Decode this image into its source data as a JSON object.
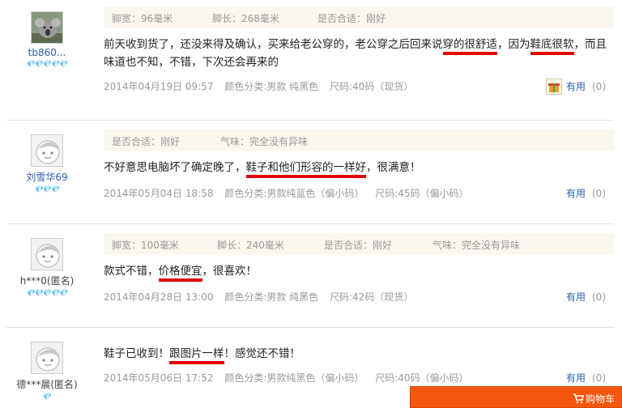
{
  "reviews": [
    {
      "user": {
        "name": "tb860...",
        "hearts": "💎💎💎💎💎"
      },
      "attrs": [
        "脚宽：96毫米",
        "脚长：268毫米",
        "是否合适：刚好"
      ],
      "content": {
        "p1": "前天收到货了，还没来得及确认，买来给老公穿的，老公穿之后回来说",
        "h1": "穿的很舒适",
        "p2": "，因为",
        "h2": "鞋底很软",
        "p3": "，而且味道也不知，不错，下次还会再来的"
      },
      "date": "2014年04月19日 09:57",
      "color": "颜色分类:男款 纯黑色",
      "size": "尺码:40码（现货）",
      "useful_label": "有用",
      "useful_count": "(0)"
    },
    {
      "user": {
        "name": "刘雪华69",
        "hearts": "💎💎💎"
      },
      "attrs": [
        "是否合适：刚好",
        "气味：完全没有异味"
      ],
      "content": {
        "p1": "不好意思电脑坏了确定晚了，",
        "h1": "鞋子和他们形容的一样好",
        "p2": "，很满意！"
      },
      "date": "2014年05月04日 18:58",
      "color": "颜色分类:男款纯蓝色（偏小码）",
      "size": "尺码:45码（偏小码）",
      "useful_label": "有用",
      "useful_count": "(0)"
    },
    {
      "user": {
        "name": "h***0(匿名)",
        "hearts": "💎💎💎💎💎"
      },
      "attrs": [
        "脚宽：100毫米",
        "脚长：240毫米",
        "是否合适：刚好",
        "气味：完全没有异味"
      ],
      "content": {
        "p1": "款式不错，",
        "h1": "价格便宜",
        "p2": "，很喜欢！"
      },
      "date": "2014年04月28日 13:00",
      "color": "颜色分类:男款 纯黑色",
      "size": "尺码:42码（现货）",
      "useful_label": "有用",
      "useful_count": "(0)"
    },
    {
      "user": {
        "name": "德***晨(匿名)",
        "hearts": "💎"
      },
      "content": {
        "p1": "鞋子已收到！",
        "h1": "跟图片一样",
        "p2": "！感觉还不错！"
      },
      "date": "2014年05月06日 17:52",
      "color": "颜色分类:男款纯黑色（偏小码）",
      "size": "尺码:40码（偏小码）",
      "useful_label": "有用",
      "useful_count": "(0)"
    }
  ],
  "cart": {
    "label": "购物车",
    "icon": "cart-icon",
    "color": "#f5570e"
  },
  "colors": {
    "highlight": "#e00000",
    "link": "#2b5ea8",
    "attr_bg": "#fbf6ee"
  }
}
